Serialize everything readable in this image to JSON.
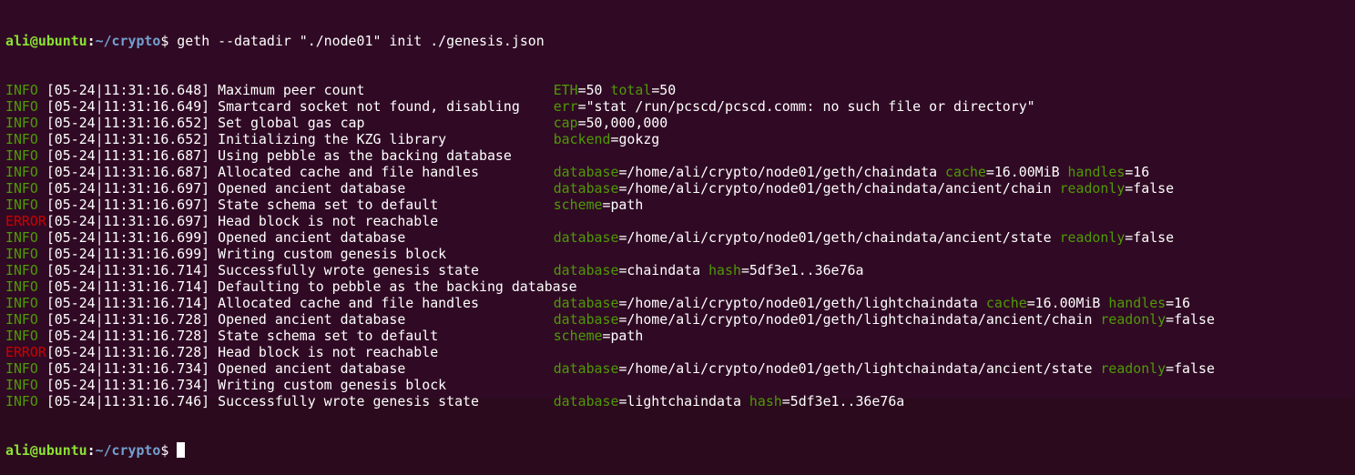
{
  "prompt": {
    "user_host": "ali@ubuntu",
    "separator": ":",
    "path": "~/crypto",
    "dollar": "$ "
  },
  "command": "geth --datadir \"./node01\" init ./genesis.json",
  "logs": [
    {
      "level": "INFO ",
      "ts": "[05-24|11:31:16.648]",
      "msg": "Maximum peer count",
      "fields": [
        {
          "k": "ETH",
          "v": "50"
        },
        {
          "k": "total",
          "v": "50"
        }
      ]
    },
    {
      "level": "INFO ",
      "ts": "[05-24|11:31:16.649]",
      "msg": "Smartcard socket not found, disabling",
      "fields": [
        {
          "k": "err",
          "v": "\"stat /run/pcscd/pcscd.comm: no such file or directory\""
        }
      ]
    },
    {
      "level": "INFO ",
      "ts": "[05-24|11:31:16.652]",
      "msg": "Set global gas cap",
      "fields": [
        {
          "k": "cap",
          "v": "50,000,000"
        }
      ]
    },
    {
      "level": "INFO ",
      "ts": "[05-24|11:31:16.652]",
      "msg": "Initializing the KZG library",
      "fields": [
        {
          "k": "backend",
          "v": "gokzg"
        }
      ]
    },
    {
      "level": "INFO ",
      "ts": "[05-24|11:31:16.687]",
      "msg": "Using pebble as the backing database",
      "fields": []
    },
    {
      "level": "INFO ",
      "ts": "[05-24|11:31:16.687]",
      "msg": "Allocated cache and file handles",
      "fields": [
        {
          "k": "database",
          "v": "/home/ali/crypto/node01/geth/chaindata"
        },
        {
          "k": "cache",
          "v": "16.00MiB"
        },
        {
          "k": "handles",
          "v": "16"
        }
      ]
    },
    {
      "level": "INFO ",
      "ts": "[05-24|11:31:16.697]",
      "msg": "Opened ancient database",
      "fields": [
        {
          "k": "database",
          "v": "/home/ali/crypto/node01/geth/chaindata/ancient/chain"
        },
        {
          "k": "readonly",
          "v": "false"
        }
      ]
    },
    {
      "level": "INFO ",
      "ts": "[05-24|11:31:16.697]",
      "msg": "State schema set to default",
      "fields": [
        {
          "k": "scheme",
          "v": "path"
        }
      ]
    },
    {
      "level": "ERROR",
      "ts": "[05-24|11:31:16.697]",
      "msg": "Head block is not reachable",
      "fields": []
    },
    {
      "level": "INFO ",
      "ts": "[05-24|11:31:16.699]",
      "msg": "Opened ancient database",
      "fields": [
        {
          "k": "database",
          "v": "/home/ali/crypto/node01/geth/chaindata/ancient/state"
        },
        {
          "k": "readonly",
          "v": "false"
        }
      ]
    },
    {
      "level": "INFO ",
      "ts": "[05-24|11:31:16.699]",
      "msg": "Writing custom genesis block",
      "fields": []
    },
    {
      "level": "INFO ",
      "ts": "[05-24|11:31:16.714]",
      "msg": "Successfully wrote genesis state",
      "fields": [
        {
          "k": "database",
          "v": "chaindata"
        },
        {
          "k": "hash",
          "v": "5df3e1..36e76a"
        }
      ]
    },
    {
      "level": "INFO ",
      "ts": "[05-24|11:31:16.714]",
      "msg": "Defaulting to pebble as the backing database",
      "fields": []
    },
    {
      "level": "INFO ",
      "ts": "[05-24|11:31:16.714]",
      "msg": "Allocated cache and file handles",
      "fields": [
        {
          "k": "database",
          "v": "/home/ali/crypto/node01/geth/lightchaindata"
        },
        {
          "k": "cache",
          "v": "16.00MiB"
        },
        {
          "k": "handles",
          "v": "16"
        }
      ]
    },
    {
      "level": "INFO ",
      "ts": "[05-24|11:31:16.728]",
      "msg": "Opened ancient database",
      "fields": [
        {
          "k": "database",
          "v": "/home/ali/crypto/node01/geth/lightchaindata/ancient/chain"
        },
        {
          "k": "readonly",
          "v": "false"
        }
      ]
    },
    {
      "level": "INFO ",
      "ts": "[05-24|11:31:16.728]",
      "msg": "State schema set to default",
      "fields": [
        {
          "k": "scheme",
          "v": "path"
        }
      ]
    },
    {
      "level": "ERROR",
      "ts": "[05-24|11:31:16.728]",
      "msg": "Head block is not reachable",
      "fields": []
    },
    {
      "level": "INFO ",
      "ts": "[05-24|11:31:16.734]",
      "msg": "Opened ancient database",
      "fields": [
        {
          "k": "database",
          "v": "/home/ali/crypto/node01/geth/lightchaindata/ancient/state"
        },
        {
          "k": "readonly",
          "v": "false"
        }
      ]
    },
    {
      "level": "INFO ",
      "ts": "[05-24|11:31:16.734]",
      "msg": "Writing custom genesis block",
      "fields": []
    },
    {
      "level": "INFO ",
      "ts": "[05-24|11:31:16.746]",
      "msg": "Successfully wrote genesis state",
      "fields": [
        {
          "k": "database",
          "v": "lightchaindata"
        },
        {
          "k": "hash",
          "v": "5df3e1..36e76a"
        }
      ]
    }
  ],
  "colors": {
    "background": "#300a24",
    "info": "#4e9a06",
    "error": "#cc0000",
    "prompt_user": "#8ae234",
    "prompt_path": "#729fcf"
  }
}
